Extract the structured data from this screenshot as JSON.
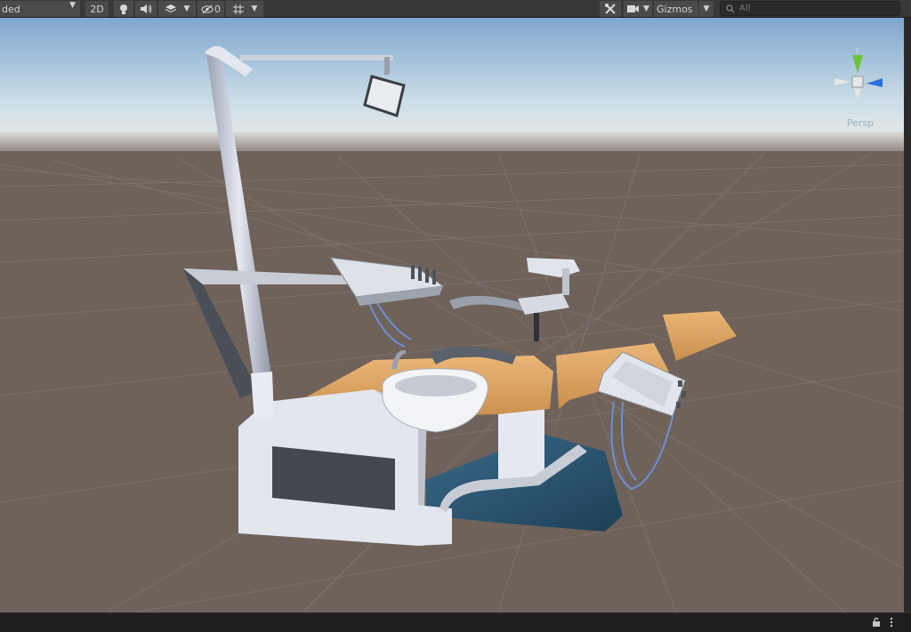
{
  "toolbar": {
    "draw_mode_label": "ded",
    "mode_2d_label": "2D",
    "hidden_count": "0",
    "gizmos_label": "Gizmos",
    "search_placeholder": "All"
  },
  "scene": {
    "persp_label": "Persp",
    "axis_y_label": "y",
    "axis_x_label": "x"
  },
  "icons": {
    "dropdown": "caret-down-icon",
    "lighting": "lightbulb-icon",
    "audio": "speaker-icon",
    "effects": "layers-icon",
    "visibility": "eye-slash-icon",
    "grid": "grid-icon",
    "tools": "tools-icon",
    "camera": "camera-icon",
    "search": "search-icon",
    "lock": "lock-icon",
    "menu": "kebab-menu-icon"
  },
  "colors": {
    "toolbar_bg": "#383838",
    "sky_top": "#7fa6cf",
    "ground": "#6e625b",
    "upholstery": "#e0a864",
    "base": "#2b5875"
  }
}
